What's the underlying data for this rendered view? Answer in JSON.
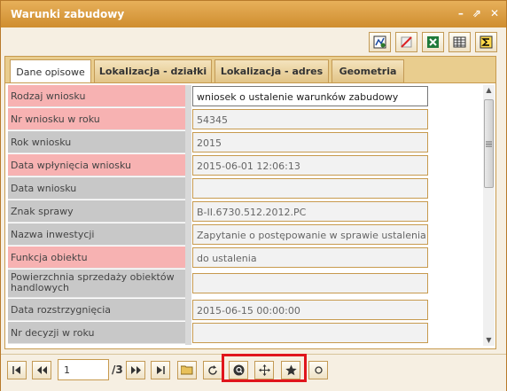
{
  "window": {
    "title": "Warunki zabudowy"
  },
  "title_controls": {
    "minimize": "–",
    "popout": "⇗",
    "close": "✕"
  },
  "toolbar": {
    "buttons": [
      {
        "name": "report-icon"
      },
      {
        "name": "clear-icon"
      },
      {
        "name": "excel-icon"
      },
      {
        "name": "table-icon"
      },
      {
        "name": "sum-icon"
      }
    ]
  },
  "tabs": [
    {
      "label": "Dane opisowe",
      "active": true
    },
    {
      "label": "Lokalizacja - działki",
      "active": false
    },
    {
      "label": "Lokalizacja - adres",
      "active": false
    },
    {
      "label": "Geometria",
      "active": false
    }
  ],
  "form": {
    "rows": [
      {
        "label": "Rodzaj wniosku",
        "value": "wniosek o ustalenie warunków zabudowy",
        "required": true
      },
      {
        "label": "Nr wniosku w roku",
        "value": "54345",
        "required": true
      },
      {
        "label": "Rok wniosku",
        "value": "2015",
        "required": false
      },
      {
        "label": "Data wpłynięcia wniosku",
        "value": "2015-06-01 12:06:13",
        "required": true
      },
      {
        "label": "Data wniosku",
        "value": "",
        "required": false
      },
      {
        "label": "Znak sprawy",
        "value": "B-II.6730.512.2012.PC",
        "required": false
      },
      {
        "label": "Nazwa inwestycji",
        "value": "Zapytanie o postępowanie w sprawie ustalenia warunl",
        "required": false
      },
      {
        "label": "Funkcja obiektu",
        "value": "do ustalenia",
        "required": true
      },
      {
        "label": "Powierzchnia sprzedaży obiektów handlowych",
        "value": "",
        "required": false
      },
      {
        "label": "Data rozstrzygnięcia",
        "value": "2015-06-15 00:00:00",
        "required": false
      },
      {
        "label": "Nr decyzji w roku",
        "value": "",
        "required": false
      }
    ]
  },
  "pager": {
    "current_page": "1",
    "total": "/3"
  },
  "colors": {
    "accent": "#cf8d2f",
    "required_label": "#f7b2b2",
    "highlight": "#e0151c"
  }
}
